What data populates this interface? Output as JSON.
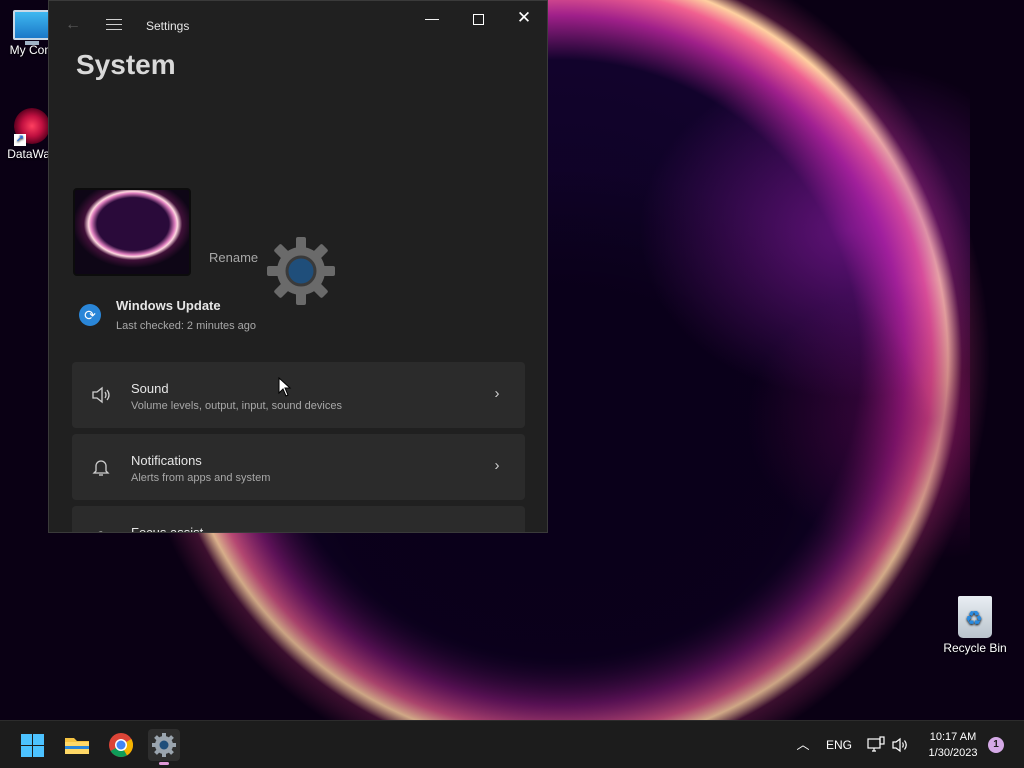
{
  "desktop": {
    "icons": [
      {
        "label": "My Com",
        "icon": "computer-icon"
      },
      {
        "label": "DataWag",
        "icon": "datawag-shortcut-icon"
      },
      {
        "label": "Recycle Bin",
        "icon": "recycle-bin-icon"
      }
    ]
  },
  "window": {
    "app_title": "Settings",
    "page_title": "System",
    "rename_label": "Rename",
    "update": {
      "title": "Windows Update",
      "subtitle": "Last checked: 2 minutes ago"
    },
    "cards": [
      {
        "title": "Sound",
        "subtitle": "Volume levels, output, input, sound devices",
        "icon": "speaker-icon"
      },
      {
        "title": "Notifications",
        "subtitle": "Alerts from apps and system",
        "icon": "bell-icon"
      },
      {
        "title": "Focus assist",
        "subtitle": "",
        "icon": "moon-icon"
      }
    ],
    "controls": {
      "minimize": "—",
      "maximize": "",
      "close": "✕",
      "back": "←"
    }
  },
  "taskbar": {
    "apps": [
      "start-icon",
      "file-explorer-icon",
      "chrome-icon",
      "settings-icon"
    ],
    "tray": {
      "language": "ENG",
      "time": "10:17 AM",
      "date": "1/30/2023",
      "notification_count": "1"
    }
  },
  "colors": {
    "accent": "#4cc2ff",
    "window_bg": "#202020",
    "card_bg": "#2b2b2b",
    "taskbar_bg": "#1c1c1c"
  }
}
